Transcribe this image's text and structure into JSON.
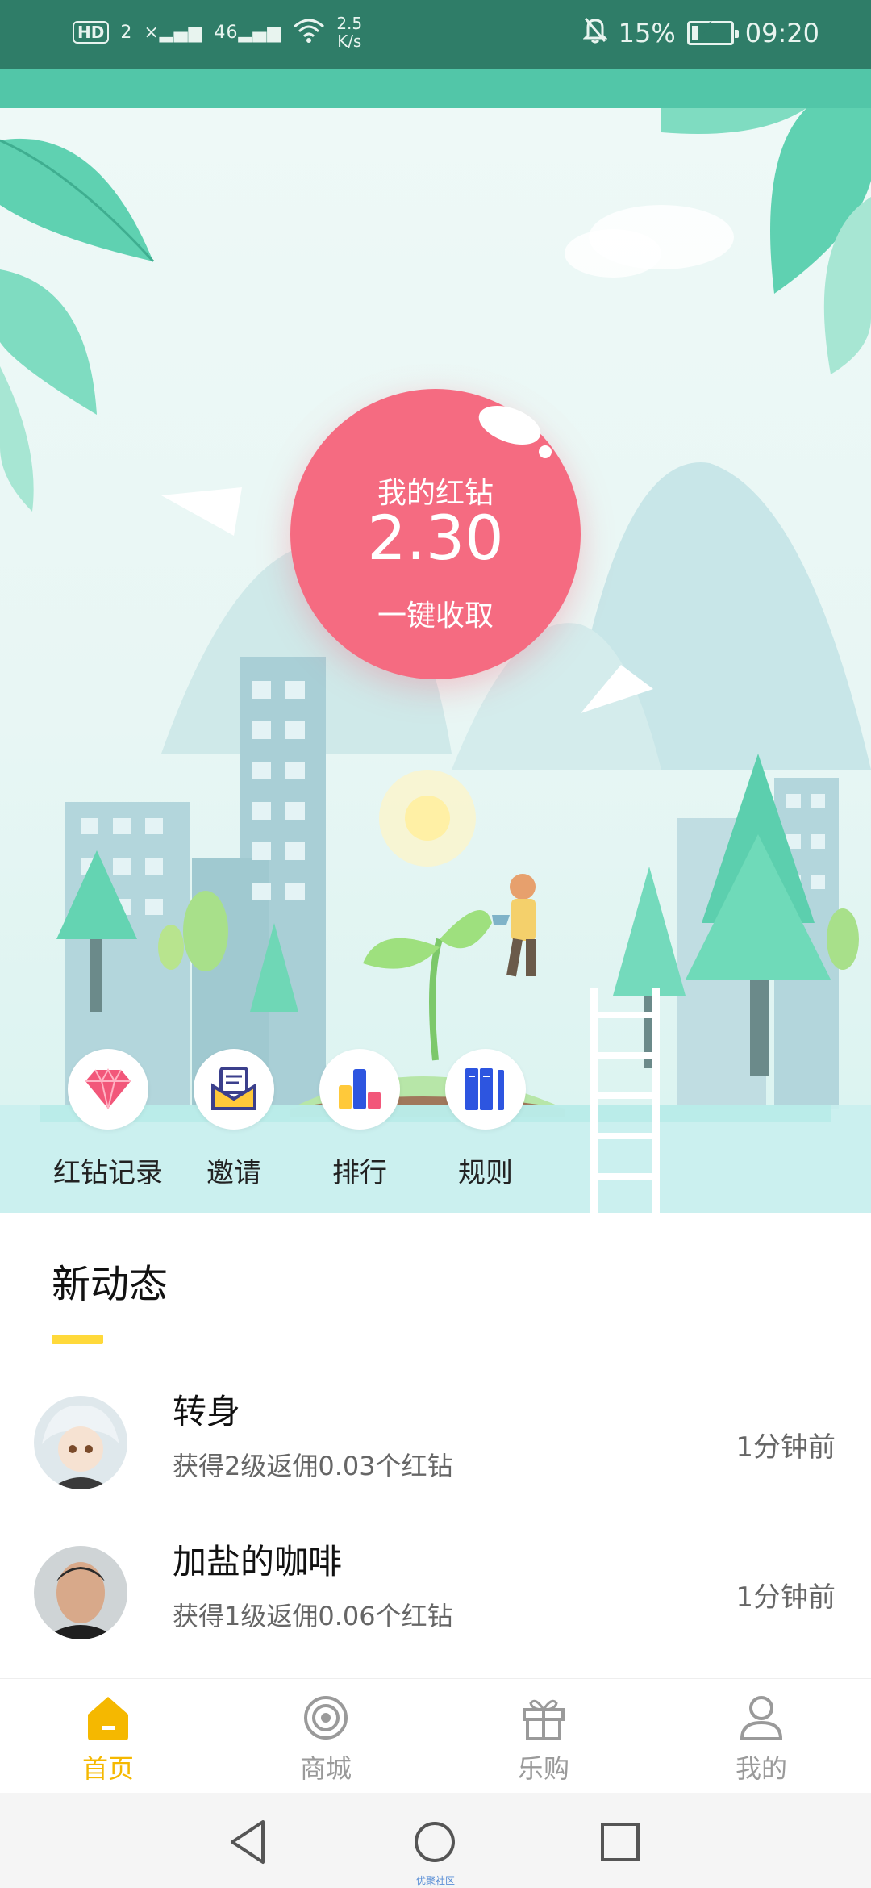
{
  "status_bar": {
    "hd": "HD",
    "sim": "2",
    "net1": "×▂▄▆",
    "net2": "46▂▄▆",
    "speed_value": "2.5",
    "speed_unit": "K/s",
    "battery_pct": "15%",
    "battery_level": 0.15,
    "time": "09:20"
  },
  "hero": {
    "orb_title": "我的红钻",
    "orb_value": "2.30",
    "orb_action": "一键收取"
  },
  "actions": [
    {
      "label": "红钻记录",
      "icon": "diamond-icon"
    },
    {
      "label": "邀请",
      "icon": "envelope-icon"
    },
    {
      "label": "排行",
      "icon": "bar-chart-icon"
    },
    {
      "label": "规则",
      "icon": "books-icon"
    }
  ],
  "feed": {
    "title": "新动态",
    "items": [
      {
        "name": "转身",
        "desc": "获得2级返佣0.03个红钻",
        "time": "1分钟前"
      },
      {
        "name": "加盐的咖啡",
        "desc": "获得1级返佣0.06个红钻",
        "time": "1分钟前"
      }
    ]
  },
  "tabs": [
    {
      "label": "首页",
      "icon": "home-icon",
      "active": true
    },
    {
      "label": "商城",
      "icon": "target-icon",
      "active": false
    },
    {
      "label": "乐购",
      "icon": "gift-icon",
      "active": false
    },
    {
      "label": "我的",
      "icon": "person-icon",
      "active": false
    }
  ],
  "nav": {
    "watermark": "优聚社区"
  },
  "colors": {
    "status_bg": "#2f7d68",
    "accent_teal": "#52c6a8",
    "orb_pink": "#f56b81",
    "tab_active": "#f5b800",
    "underline_yellow": "#ffd93a"
  }
}
